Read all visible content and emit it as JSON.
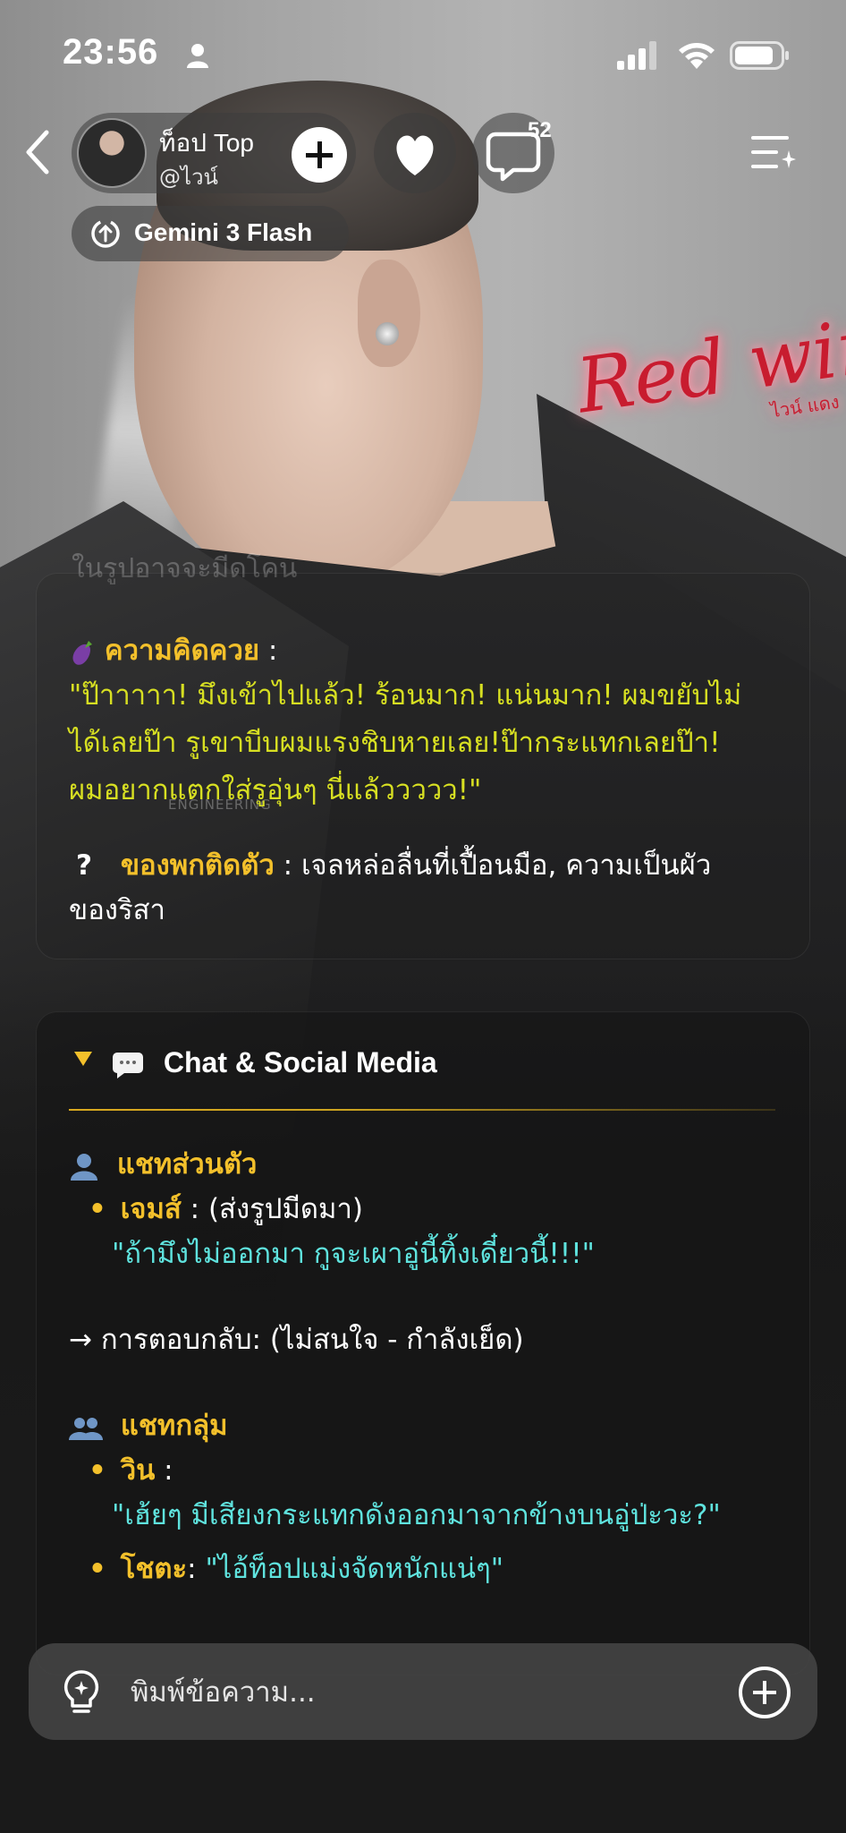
{
  "status_bar": {
    "time": "23:56"
  },
  "header": {
    "profile_name": "ท็อป Top",
    "profile_handle": "@ไวน์",
    "comment_count": "52",
    "model_label": "Gemini 3 Flash"
  },
  "background": {
    "watermark_text": "Red wine",
    "watermark_sub": "ไวน์ แดง",
    "faded_text": "ในรูปอาจจะมีดโคน",
    "shirt_text": "ENGINEERING"
  },
  "card1": {
    "thought_label": "ความคิดควย",
    "thought_sep": ":",
    "thought_line1": "\"ป๊าาาาา! มึงเข้าไปแล้ว! ร้อนมาก! แน่นมาก! ผมขยับไม่",
    "thought_line2": "ได้เลยป๊า รูเขาบีบผมแรงชิบหายเลย!ป๊ากระแทกเลยป๊า!",
    "thought_line3": "ผมอยากแตกใส่รูอุ่นๆ นี่แล้ววววว!\"",
    "items_icon": "?",
    "items_label": "ของพกติดตัว",
    "items_line1": ": เจลหล่อลื่นที่เปื้อนมือ, ความเป็นผัว",
    "items_line2": "ของริสา"
  },
  "card2": {
    "section_title": "Chat & Social Media",
    "private_chat_label": "แชทส่วนตัว",
    "private_bullet": "•",
    "private_sender": "เจมส์",
    "private_note": " : (ส่งรูปมีดมา)",
    "private_message": "\"ถ้ามึงไม่ออกมา กูจะเผาอู่นี้ทิ้งเดี๋ยวนี้!!!\"",
    "reply_line": "→ การตอบกลับ: (ไม่สนใจ - กำลังเย็ด)",
    "group_chat_label": "แชทกลุ่ม",
    "group_sender1": "วิน",
    "group_sep1": " :",
    "group_message1": "\"เฮ้ยๆ มีเสียงกระแทกดังออกมาจากข้างบนอู่ป่ะวะ?\"",
    "group_sender2": "โชตะ",
    "group_sep2": ": ",
    "group_message2": "\"ไอ้ท็อปแม่งจัดหนักแน่ๆ\""
  },
  "input": {
    "placeholder": "พิมพ์ข้อความ..."
  }
}
